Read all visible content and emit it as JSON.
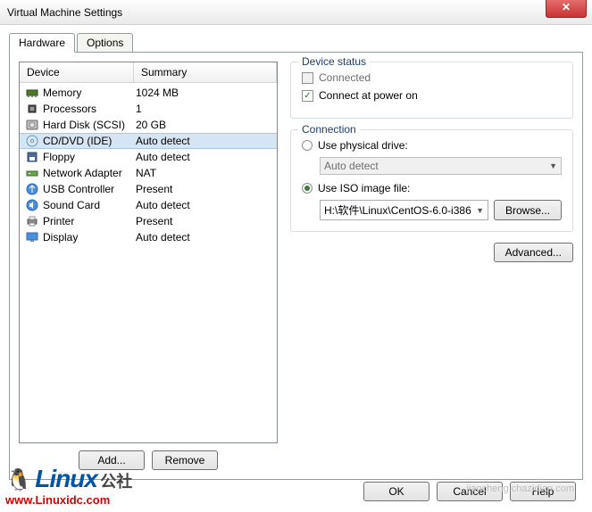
{
  "title": "Virtual Machine Settings",
  "tabs": {
    "hardware": "Hardware",
    "options": "Options"
  },
  "headers": {
    "device": "Device",
    "summary": "Summary"
  },
  "devices": [
    {
      "icon": "memory",
      "name": "Memory",
      "summary": "1024 MB",
      "selected": false
    },
    {
      "icon": "cpu",
      "name": "Processors",
      "summary": "1",
      "selected": false
    },
    {
      "icon": "hdd",
      "name": "Hard Disk (SCSI)",
      "summary": "20 GB",
      "selected": false
    },
    {
      "icon": "cd",
      "name": "CD/DVD (IDE)",
      "summary": "Auto detect",
      "selected": true
    },
    {
      "icon": "floppy",
      "name": "Floppy",
      "summary": "Auto detect",
      "selected": false
    },
    {
      "icon": "net",
      "name": "Network Adapter",
      "summary": "NAT",
      "selected": false
    },
    {
      "icon": "usb",
      "name": "USB Controller",
      "summary": "Present",
      "selected": false
    },
    {
      "icon": "sound",
      "name": "Sound Card",
      "summary": "Auto detect",
      "selected": false
    },
    {
      "icon": "printer",
      "name": "Printer",
      "summary": "Present",
      "selected": false
    },
    {
      "icon": "display",
      "name": "Display",
      "summary": "Auto detect",
      "selected": false
    }
  ],
  "buttons": {
    "add": "Add...",
    "remove": "Remove",
    "browse": "Browse...",
    "advanced": "Advanced...",
    "ok": "OK",
    "cancel": "Cancel",
    "help": "Help"
  },
  "status": {
    "group": "Device status",
    "connected": "Connected",
    "connect_power": "Connect at power on"
  },
  "connection": {
    "group": "Connection",
    "physical": "Use physical drive:",
    "physical_value": "Auto detect",
    "iso": "Use ISO image file:",
    "iso_value": "H:\\软件\\Linux\\CentOS-6.0-i386"
  },
  "watermark": {
    "brand": "Linux",
    "suffix": "公社",
    "url": "www.Linuxidc.com",
    "right": "jiaocheng.chazidian.com"
  }
}
